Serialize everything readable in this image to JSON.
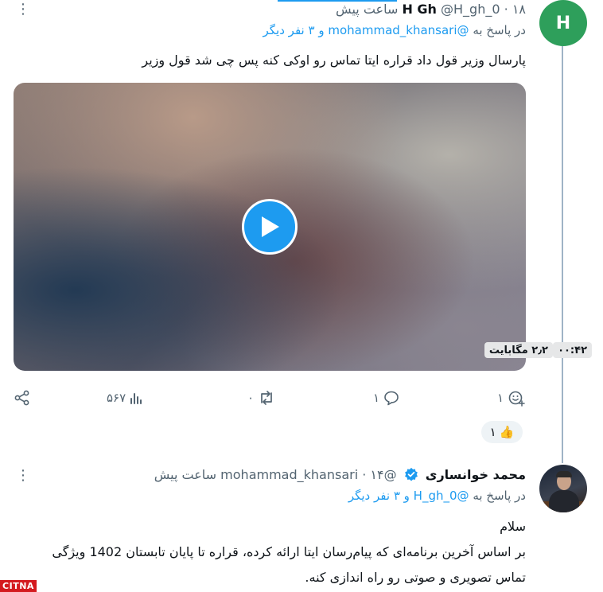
{
  "tweet1": {
    "avatar_letter": "H",
    "name": "H Gh",
    "handle": "@H_gh_0",
    "separator": "·",
    "time": "۱۸ ساعت پیش",
    "reply_prefix": "در پاسخ به",
    "reply_mention": "@mohammad_khansari",
    "reply_suffix": "و ۳ نفر دیگر",
    "text": "پارسال وزیر قول داد قراره ایتا تماس رو اوکی کنه پس چی شد قول وزیر",
    "video": {
      "duration": "۰۰:۴۲",
      "size": "۲٫۲ مگابایت"
    },
    "actions": {
      "reactions": "۱",
      "replies": "۱",
      "retweets": "۰",
      "views": "۵۶۷"
    },
    "reaction_chip": {
      "emoji": "👍",
      "count": "۱"
    }
  },
  "tweet2": {
    "name": "محمد خوانساری",
    "handle": "@mohammad_khansari",
    "separator": "·",
    "time": "۱۴ ساعت پیش",
    "reply_prefix": "در پاسخ به",
    "reply_mention": "@H_gh_0",
    "reply_suffix": "و ۳ نفر دیگر",
    "text_line1": "سلام",
    "text_line2": "بر اساس آخرین برنامه‌ای که پیام‌رسان ایتا ارائه کرده، قراره تا پایان تابستان 1402 ویژگی",
    "text_line3": "تماس تصویری و صوتی رو راه اندازی کنه."
  },
  "watermark": "CITNA",
  "colors": {
    "accent": "#1d9bf0",
    "avatar_bg": "#2e9f5b",
    "muted_text": "#536471",
    "watermark_bg": "#d41a1f"
  }
}
